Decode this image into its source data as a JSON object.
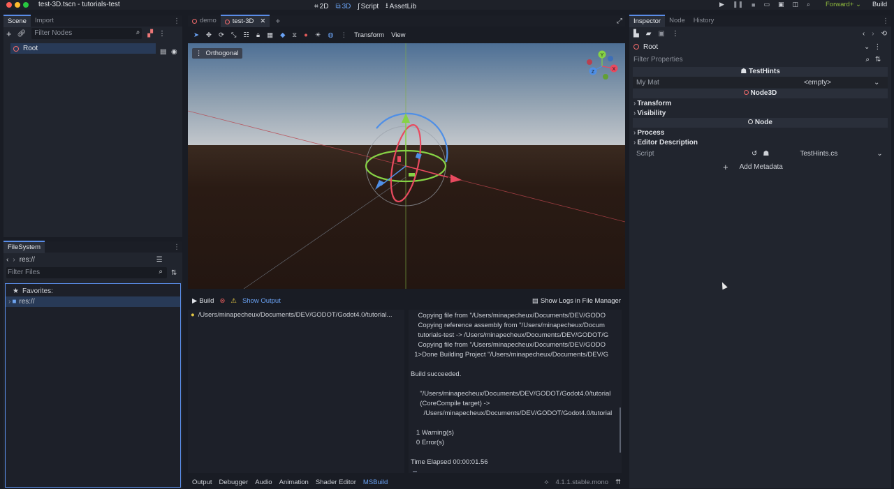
{
  "titlebar": {
    "title": "test-3D.tscn - tutorials-test",
    "modes": [
      {
        "label": "2D",
        "icon": "2d-icon"
      },
      {
        "label": "3D",
        "icon": "3d-icon"
      },
      {
        "label": "Script",
        "icon": "script-icon"
      },
      {
        "label": "AssetLib",
        "icon": "assetlib-icon"
      }
    ],
    "renderer": "Forward+",
    "build": "Build"
  },
  "scene_dock": {
    "tabs": [
      "Scene",
      "Import"
    ],
    "filter_placeholder": "Filter Nodes",
    "root_node": "Root"
  },
  "filesystem": {
    "title": "FileSystem",
    "path": "res://",
    "filter_placeholder": "Filter Files",
    "favorites": "Favorites:",
    "res_item": "res://"
  },
  "editor_tabs": [
    "demo",
    "test-3D"
  ],
  "viewport_toolbar": {
    "transform": "Transform",
    "view": "View"
  },
  "viewport": {
    "projection": "Orthogonal",
    "gizmo_axes": [
      "Y",
      "X",
      "Z"
    ]
  },
  "bottom_panel": {
    "build": "Build",
    "show_output": "Show Output",
    "show_logs": "Show Logs in File Manager",
    "project_path": "/Users/minapecheux/Documents/DEV/GODOT/Godot4.0/tutorial...",
    "log_lines": [
      "    Copying file from \"/Users/minapecheux/Documents/DEV/GODO",
      "    Copying reference assembly from \"/Users/minapecheux/Docum",
      "    tutorials-test -> /Users/minapecheux/Documents/DEV/GODOT/G",
      "    Copying file from \"/Users/minapecheux/Documents/DEV/GODO",
      "  1>Done Building Project \"/Users/minapecheux/Documents/DEV/G",
      "",
      "Build succeeded.",
      "",
      "     \"/Users/minapecheux/Documents/DEV/GODOT/Godot4.0/tutorial",
      "     (CoreCompile target) ->",
      "       /Users/minapecheux/Documents/DEV/GODOT/Godot4.0/tutorial",
      "",
      "   1 Warning(s)",
      "   0 Error(s)",
      "",
      "Time Elapsed 00:00:01.56"
    ],
    "tabs": [
      "Output",
      "Debugger",
      "Audio",
      "Animation",
      "Shader Editor",
      "MSBuild"
    ],
    "version": "4.1.1.stable.mono"
  },
  "inspector": {
    "tabs": [
      "Inspector",
      "Node",
      "History"
    ],
    "node_name": "Root",
    "filter_placeholder": "Filter Properties",
    "section_testhints": "TestHints",
    "my_mat_label": "My Mat",
    "my_mat_value": "<empty>",
    "section_node3d": "Node3D",
    "transform": "Transform",
    "visibility": "Visibility",
    "section_node": "Node",
    "process": "Process",
    "editor_description": "Editor Description",
    "script_label": "Script",
    "script_value": "TestHints.cs",
    "add_metadata": "Add Metadata"
  },
  "colors": {
    "accent": "#5a8de8",
    "node_red": "#f26b6b",
    "x_axis": "#f04a5b",
    "y_axis": "#8bd645",
    "z_axis": "#4a8ff0"
  }
}
